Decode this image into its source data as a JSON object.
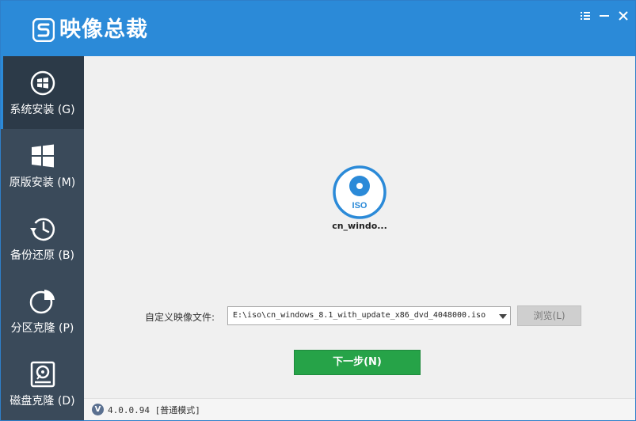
{
  "app": {
    "title": "映像总裁"
  },
  "window_controls": [
    "menu-icon",
    "minimize-icon",
    "close-icon"
  ],
  "sidebar": {
    "items": [
      {
        "label": "系统安装 (G)",
        "icon": "system-install-icon",
        "active": true
      },
      {
        "label": "原版安装 (M)",
        "icon": "windows-logo-icon",
        "active": false
      },
      {
        "label": "备份还原 (B)",
        "icon": "backup-restore-icon",
        "active": false
      },
      {
        "label": "分区克隆 (P)",
        "icon": "partition-pie-icon",
        "active": false
      },
      {
        "label": "磁盘克隆 (D)",
        "icon": "disk-clone-icon",
        "active": false
      }
    ]
  },
  "main": {
    "disc": {
      "badge": "ISO",
      "name": "cn_windo..."
    },
    "image_file": {
      "label": "自定义映像文件:",
      "value": "E:\\iso\\cn_windows_8.1_with_update_x86_dvd_4048000.iso"
    },
    "browse_label": "浏览(L)",
    "next_label": "下一步(N)"
  },
  "status": {
    "badge": "V",
    "version": "4.0.0.94 [普通模式]"
  },
  "colors": {
    "header": "#2b8ad8",
    "sidebar": "#3a4a5a",
    "sidebar_active": "#2c3a48",
    "next_button": "#26a348",
    "disc_ring": "#2b8ad8"
  }
}
